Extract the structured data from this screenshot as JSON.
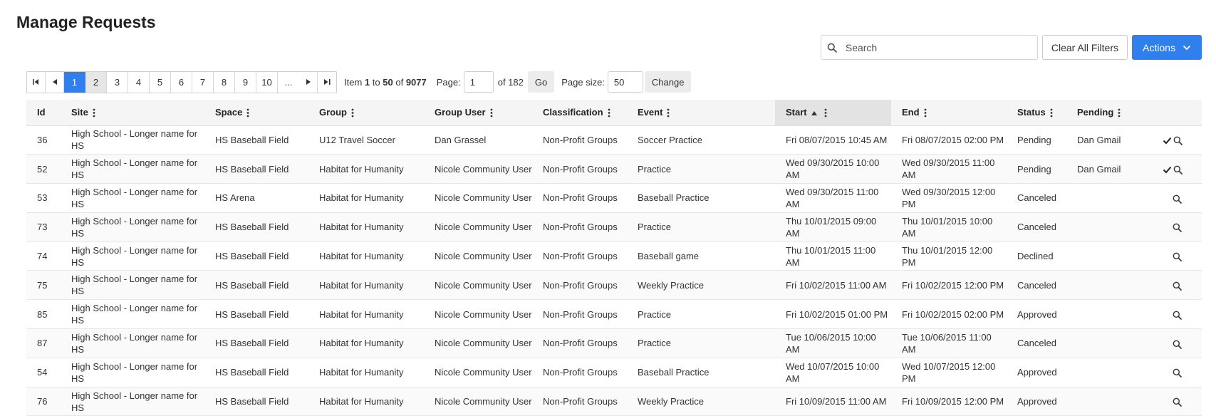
{
  "page": {
    "title": "Manage Requests"
  },
  "toolbar": {
    "search_placeholder": "Search",
    "clear_filters_label": "Clear All Filters",
    "actions_label": "Actions"
  },
  "pager": {
    "pages": [
      "1",
      "2",
      "3",
      "4",
      "5",
      "6",
      "7",
      "8",
      "9",
      "10",
      "..."
    ],
    "active_page": "1",
    "item_label": "Item",
    "item_from": "1",
    "to_label": "to",
    "item_to": "50",
    "of_label": "of",
    "item_total": "9077",
    "page_label": "Page:",
    "page_value": "1",
    "page_of": "of 182",
    "go_label": "Go",
    "page_size_label": "Page size:",
    "page_size_value": "50",
    "change_label": "Change"
  },
  "table": {
    "columns": [
      "Id",
      "Site",
      "Space",
      "Group",
      "Group User",
      "Classification",
      "Event",
      "Start",
      "End",
      "Status",
      "Pending"
    ],
    "rows": [
      {
        "id": "36",
        "site": "High School - Longer name for HS",
        "space": "HS Baseball Field",
        "group": "U12 Travel Soccer",
        "group_user": "Dan Grassel",
        "classification": "Non-Profit Groups",
        "event": "Soccer Practice",
        "start": "Fri 08/07/2015 10:45 AM",
        "end": "Fri 08/07/2015 02:00 PM",
        "status": "Pending",
        "pending": "Dan Gmail",
        "approve": true
      },
      {
        "id": "52",
        "site": "High School - Longer name for HS",
        "space": "HS Baseball Field",
        "group": "Habitat for Humanity",
        "group_user": "Nicole Community User",
        "classification": "Non-Profit Groups",
        "event": "Practice",
        "start": "Wed 09/30/2015 10:00 AM",
        "end": "Wed 09/30/2015 11:00 AM",
        "status": "Pending",
        "pending": "Dan Gmail",
        "approve": true
      },
      {
        "id": "53",
        "site": "High School - Longer name for HS",
        "space": "HS Arena",
        "group": "Habitat for Humanity",
        "group_user": "Nicole Community User",
        "classification": "Non-Profit Groups",
        "event": "Baseball Practice",
        "start": "Wed 09/30/2015 11:00 AM",
        "end": "Wed 09/30/2015 12:00 PM",
        "status": "Canceled",
        "pending": "",
        "approve": false
      },
      {
        "id": "73",
        "site": "High School - Longer name for HS",
        "space": "HS Baseball Field",
        "group": "Habitat for Humanity",
        "group_user": "Nicole Community User",
        "classification": "Non-Profit Groups",
        "event": "Practice",
        "start": "Thu 10/01/2015 09:00 AM",
        "end": "Thu 10/01/2015 10:00 AM",
        "status": "Canceled",
        "pending": "",
        "approve": false
      },
      {
        "id": "74",
        "site": "High School - Longer name for HS",
        "space": "HS Baseball Field",
        "group": "Habitat for Humanity",
        "group_user": "Nicole Community User",
        "classification": "Non-Profit Groups",
        "event": "Baseball game",
        "start": "Thu 10/01/2015 11:00 AM",
        "end": "Thu 10/01/2015 12:00 PM",
        "status": "Declined",
        "pending": "",
        "approve": false
      },
      {
        "id": "75",
        "site": "High School - Longer name for HS",
        "space": "HS Baseball Field",
        "group": "Habitat for Humanity",
        "group_user": "Nicole Community User",
        "classification": "Non-Profit Groups",
        "event": "Weekly Practice",
        "start": "Fri 10/02/2015 11:00 AM",
        "end": "Fri 10/02/2015 12:00 PM",
        "status": "Canceled",
        "pending": "",
        "approve": false
      },
      {
        "id": "85",
        "site": "High School - Longer name for HS",
        "space": "HS Baseball Field",
        "group": "Habitat for Humanity",
        "group_user": "Nicole Community User",
        "classification": "Non-Profit Groups",
        "event": "Practice",
        "start": "Fri 10/02/2015 01:00 PM",
        "end": "Fri 10/02/2015 02:00 PM",
        "status": "Approved",
        "pending": "",
        "approve": false
      },
      {
        "id": "87",
        "site": "High School - Longer name for HS",
        "space": "HS Baseball Field",
        "group": "Habitat for Humanity",
        "group_user": "Nicole Community User",
        "classification": "Non-Profit Groups",
        "event": "Practice",
        "start": "Tue 10/06/2015 10:00 AM",
        "end": "Tue 10/06/2015 11:00 AM",
        "status": "Canceled",
        "pending": "",
        "approve": false
      },
      {
        "id": "54",
        "site": "High School - Longer name for HS",
        "space": "HS Baseball Field",
        "group": "Habitat for Humanity",
        "group_user": "Nicole Community User",
        "classification": "Non-Profit Groups",
        "event": "Baseball Practice",
        "start": "Wed 10/07/2015 10:00 AM",
        "end": "Wed 10/07/2015 12:00 PM",
        "status": "Approved",
        "pending": "",
        "approve": false
      },
      {
        "id": "76",
        "site": "High School - Longer name for HS",
        "space": "HS Baseball Field",
        "group": "Habitat for Humanity",
        "group_user": "Nicole Community User",
        "classification": "Non-Profit Groups",
        "event": "Weekly Practice",
        "start": "Fri 10/09/2015 11:00 AM",
        "end": "Fri 10/09/2015 12:00 PM",
        "status": "Approved",
        "pending": "",
        "approve": false
      }
    ]
  },
  "colors": {
    "primary": "#2f80ed",
    "link": "#3b7bd4",
    "header_bg": "#f5f5f5",
    "sorted_header_bg": "#e3e3e3"
  }
}
